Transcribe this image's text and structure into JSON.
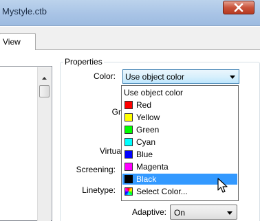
{
  "window": {
    "title": "Mystyle.ctb",
    "close_icon": "close-x-icon"
  },
  "tabs": [
    {
      "label": "View"
    }
  ],
  "properties": {
    "group_label": "Properties",
    "color": {
      "label": "Color:",
      "value": "Use object color"
    },
    "partial_labels": {
      "gr": "Gr",
      "virtua": "Virtua"
    },
    "screening": {
      "label": "Screening:"
    },
    "linetype": {
      "label": "Linetype:"
    },
    "adaptive": {
      "label": "Adaptive:",
      "value": "On"
    }
  },
  "color_dropdown": {
    "items": [
      {
        "label": "Use object color",
        "swatch": null
      },
      {
        "label": "Red",
        "swatch": "#ff0000"
      },
      {
        "label": "Yellow",
        "swatch": "#ffff00"
      },
      {
        "label": "Green",
        "swatch": "#00ff00"
      },
      {
        "label": "Cyan",
        "swatch": "#00ffff"
      },
      {
        "label": "Blue",
        "swatch": "#0000ff"
      },
      {
        "label": "Magenta",
        "swatch": "#ff00ff"
      },
      {
        "label": "Black",
        "swatch": "#000000"
      },
      {
        "label": "Select Color...",
        "swatch": "multicolor"
      }
    ],
    "highlighted": "Black"
  },
  "colors": {
    "selection": "#3399ff",
    "combo_border": "#3c7fb1"
  }
}
